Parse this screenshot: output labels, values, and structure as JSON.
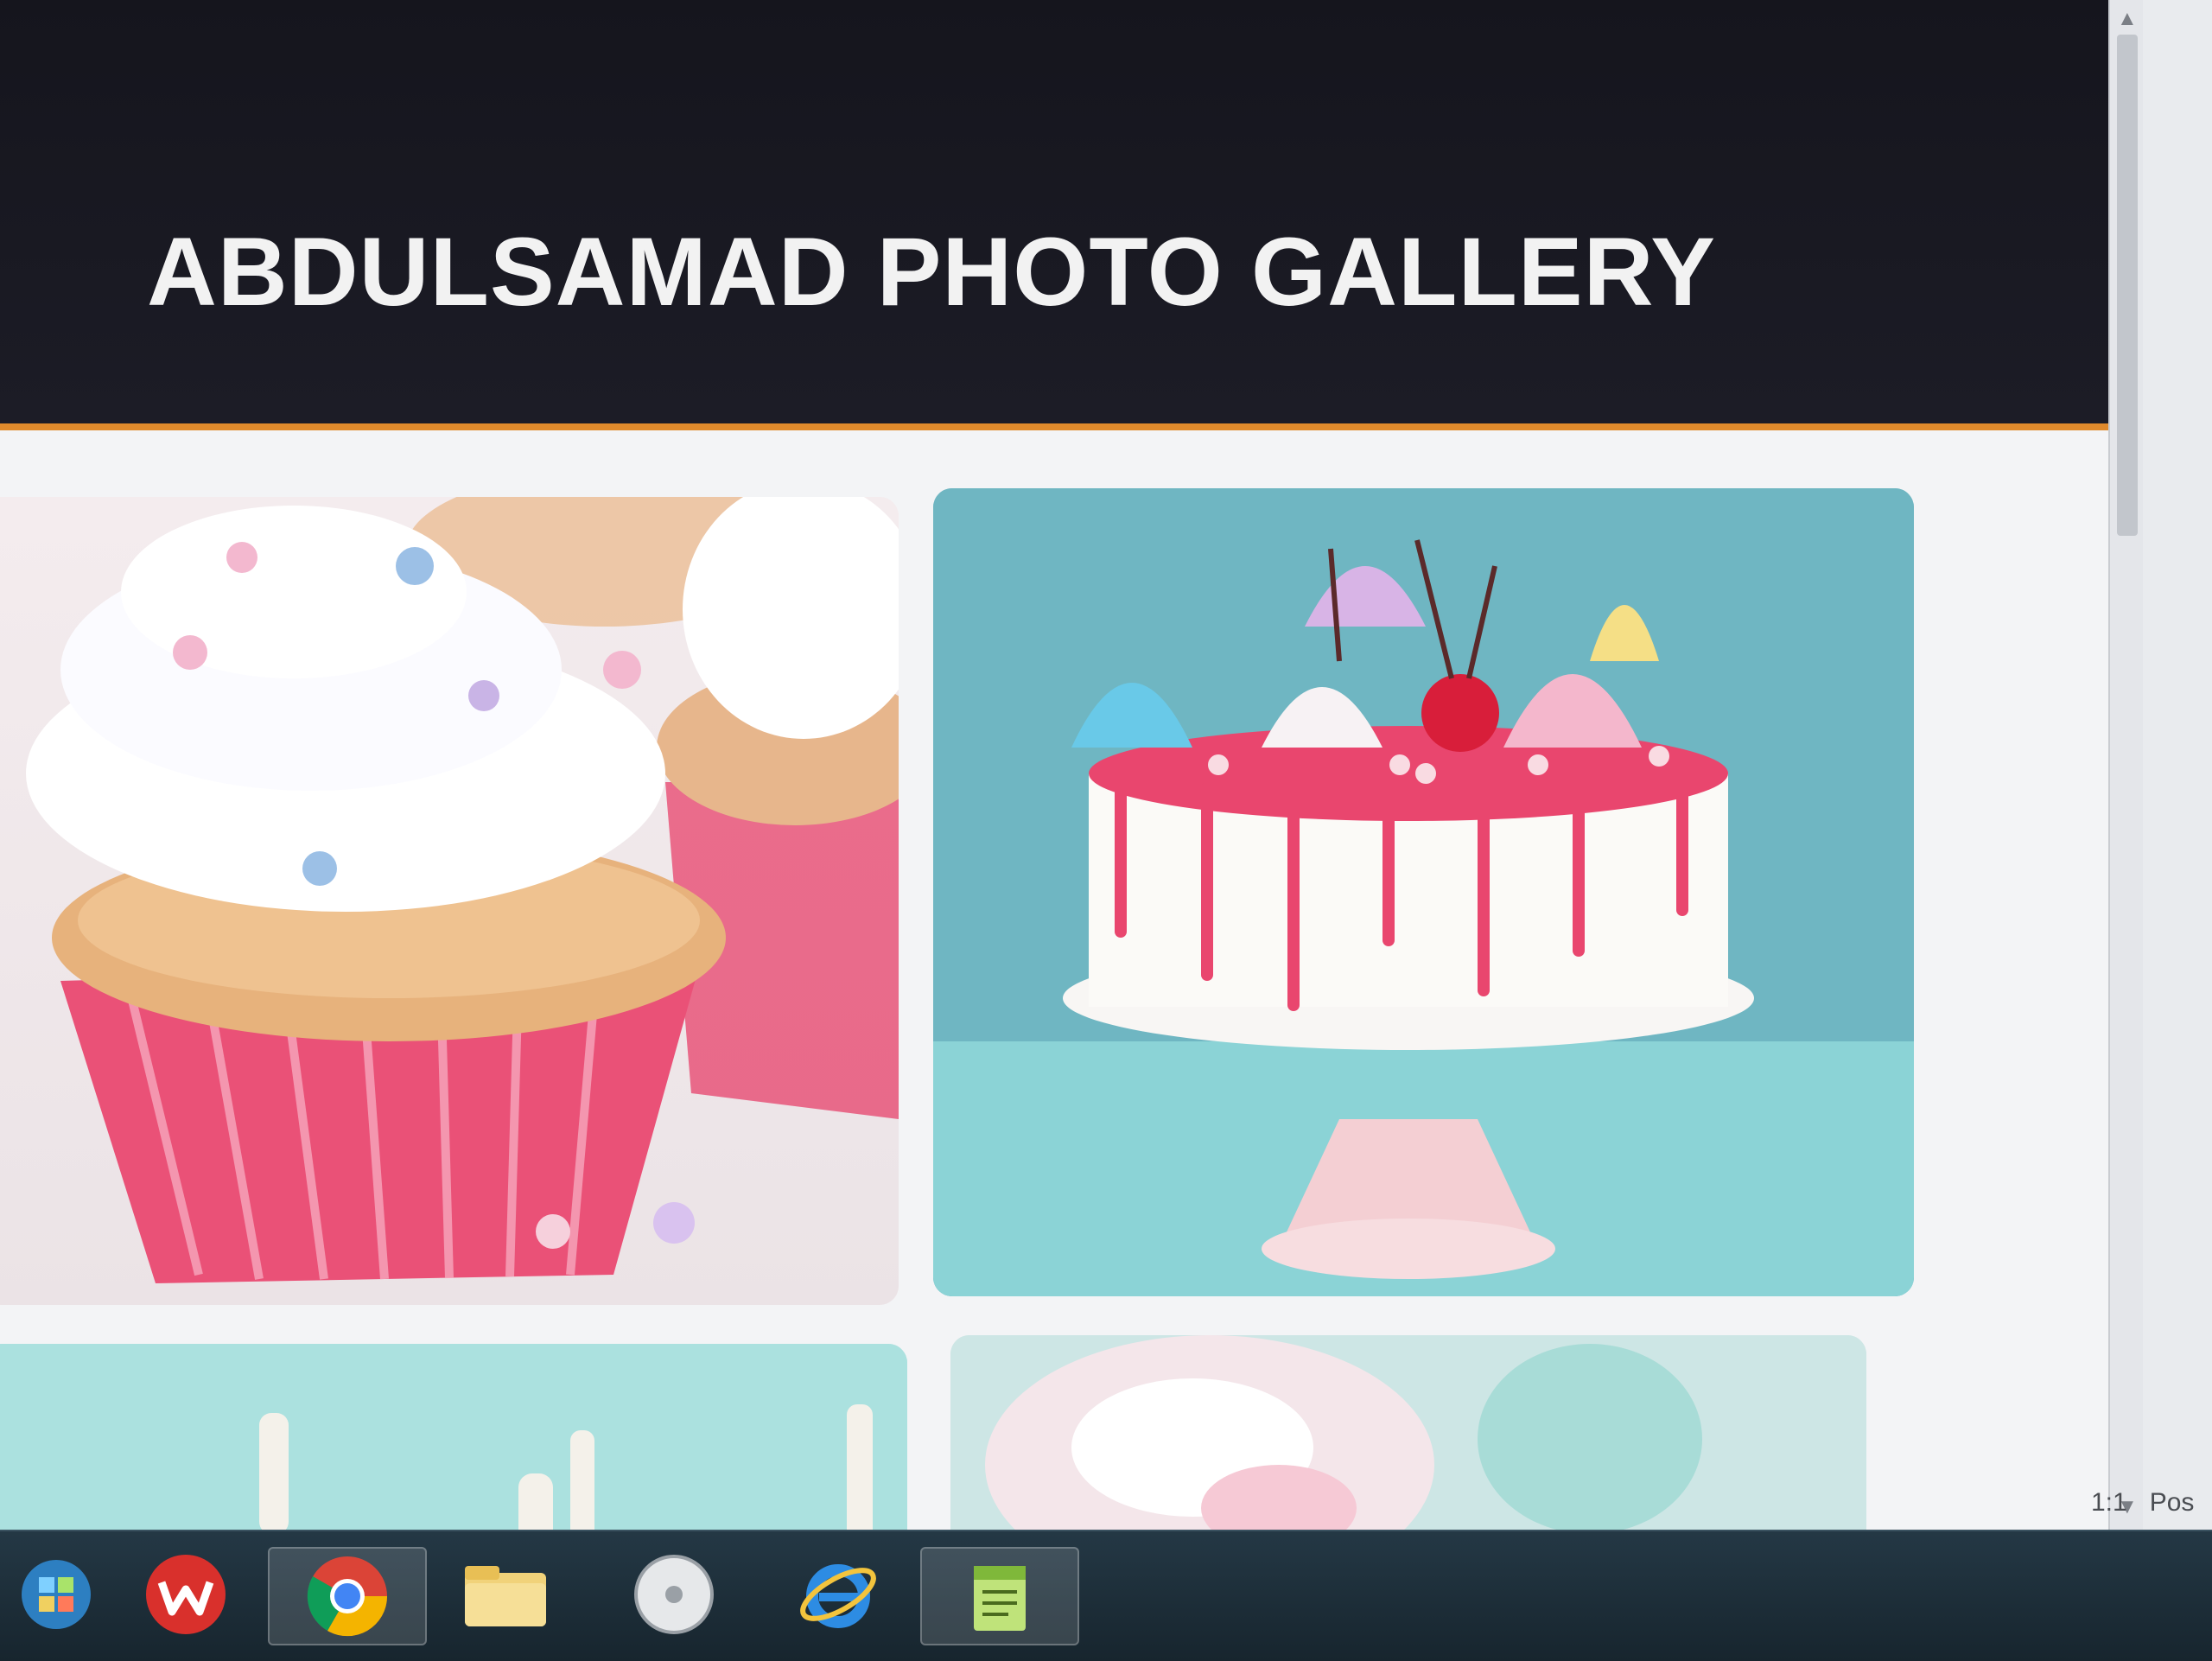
{
  "site": {
    "title": "ABDULSAMAD PHOTO GALLERY"
  },
  "gallery": {
    "images": [
      {
        "icon": "cupcakes-photo"
      },
      {
        "icon": "drip-cake-photo"
      },
      {
        "icon": "candles-photo"
      },
      {
        "icon": "meringue-photo"
      }
    ]
  },
  "editor_status": {
    "line_col": "1:1",
    "pos_label": "Pos"
  },
  "taskbar": {
    "items": [
      {
        "icon": "start-orb-icon"
      },
      {
        "icon": "wps-office-icon"
      },
      {
        "icon": "chrome-icon"
      },
      {
        "icon": "file-explorer-icon"
      },
      {
        "icon": "media-player-icon"
      },
      {
        "icon": "internet-explorer-icon"
      },
      {
        "icon": "notepad-plus-icon"
      }
    ]
  },
  "colors": {
    "header_bg": "#16161e",
    "header_accent": "#e08a2c",
    "cake_backdrop": "#73b9c4",
    "taskbar_bg": "#1d2d37"
  }
}
